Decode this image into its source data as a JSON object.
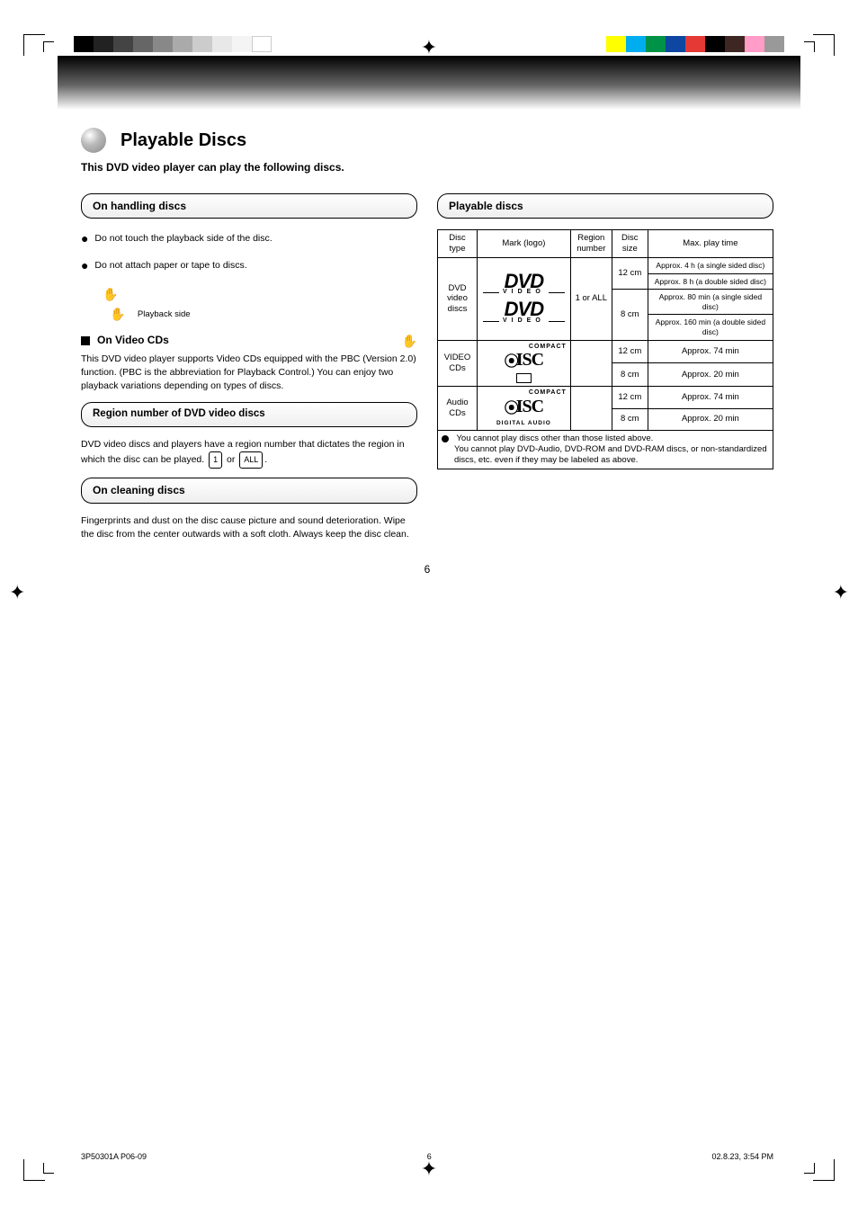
{
  "page_number": "6",
  "footer_left": "3P50301A  P06-09",
  "footer_right": "02.8.23, 3:54 PM",
  "footer_mid": "6",
  "title": "Playable Discs",
  "lead": "This DVD video player can play the following discs.",
  "left": {
    "sec1_heading": "On handling discs",
    "sec1_p1": "Do not touch the playback side of the disc.",
    "sec1_p2": "Do not attach paper or tape to discs.",
    "sec1_icon_label_1": "Playback side",
    "sec1_sub_heading": "On Video CDs",
    "sec1_sub_icon_note": ": Interactive hand icon",
    "sec1_sub_p": "This DVD video player supports Video CDs equipped with the PBC (Version 2.0) function. (PBC is the abbreviation for Playback Control.) You can enjoy two playback variations depending on types of discs.",
    "sec2_heading": "Region number of DVD video discs",
    "sec2_p": "DVD video discs and players have a region number that dictates the region in which the disc can be played.",
    "sec2_icon1": "1",
    "sec2_icon2": "ALL",
    "sec3_heading": "On cleaning discs",
    "sec3_p": "Fingerprints and dust on the disc cause picture and sound deterioration. Wipe the disc from the center outwards with a soft cloth. Always keep the disc clean."
  },
  "right": {
    "sec_heading": "Playable discs",
    "th_type": "Disc type",
    "th_mark": "Mark (logo)",
    "th_region": "Region number",
    "th_size": "Disc size",
    "th_time": "Max. play time",
    "rows": {
      "dvd_label": "DVD video discs",
      "dvd_region": "1 or ALL",
      "dvd_r1_size": "12 cm",
      "dvd_r1_time": "Approx. 4 h (a single sided disc) Approx. 8 h (a double sided disc)",
      "dvd_r2_size": "8 cm",
      "dvd_r2_time": "Approx. 80 min (a single sided disc) Approx. 160 min (a double sided disc)",
      "vcd_label": "VIDEO CDs",
      "vcd_r1_size": "12 cm",
      "vcd_r1_time": "Approx. 74 min",
      "vcd_r2_size": "8 cm",
      "vcd_r2_time": "Approx. 20 min",
      "acd_label": "Audio CDs",
      "acd_r1_size": "12 cm",
      "acd_r1_time": "Approx. 74 min",
      "acd_r2_size": "8 cm",
      "acd_r2_time": "Approx. 20 min"
    },
    "note": "You cannot play discs other than those listed above.",
    "note_extra": "You cannot play DVD-Audio, DVD-ROM and DVD-RAM discs, or non-standardized discs, etc. even if they may be labeled as above."
  }
}
